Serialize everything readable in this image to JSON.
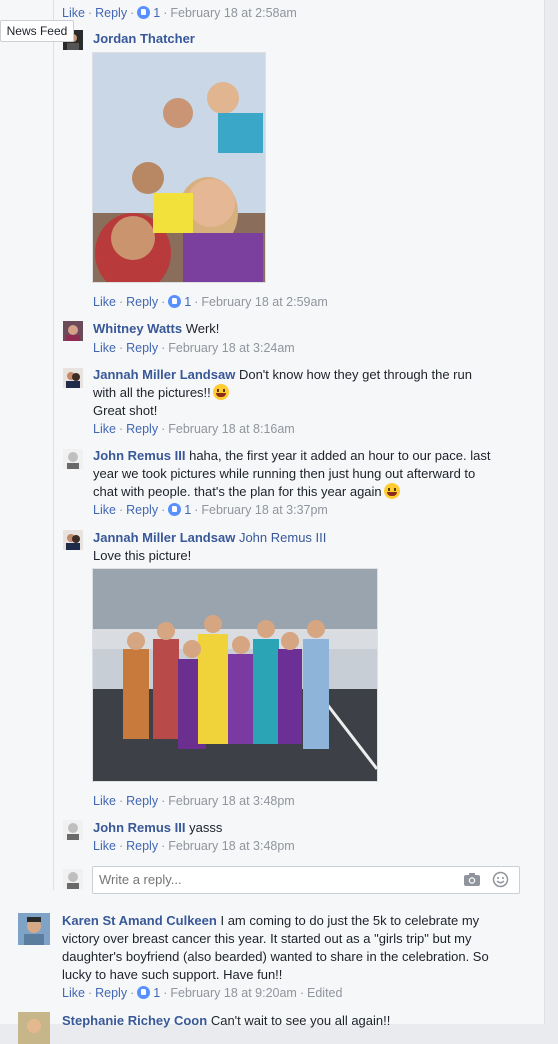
{
  "tooltip": "News Feed",
  "actions": {
    "like": "Like",
    "reply": "Reply"
  },
  "comments": [
    {
      "meta_like_count": "1",
      "time": "February 18 at 2:58am"
    },
    {
      "name": "Jordan Thatcher",
      "like_count": "1",
      "time": "February 18 at 2:59am"
    },
    {
      "name": "Whitney Watts",
      "text": "Werk!",
      "time": "February 18 at 3:24am"
    },
    {
      "name": "Jannah Miller Landsaw",
      "text_line1": "Don't know how they get through the run",
      "text_line2": "with all the pictures!!",
      "text_line3": "Great shot!",
      "time": "February 18 at 8:16am"
    },
    {
      "name": "John Remus III",
      "text_line1": "haha, the first year it added an hour to our pace. last",
      "text_line2": "year we took pictures while running then just hung out afterward to",
      "text_line3": "chat with people. that's the plan for this year again",
      "like_count": "1",
      "time": "February 18 at 3:37pm"
    },
    {
      "name": "Jannah Miller Landsaw",
      "mention": "John Remus III",
      "text": "Love this picture!",
      "time": "February 18 at 3:48pm"
    },
    {
      "name": "John Remus III",
      "text": "yasss",
      "time": "February 18 at 3:48pm"
    }
  ],
  "reply_input": {
    "placeholder": "Write a reply..."
  },
  "top_comments": [
    {
      "name": "Karen St Amand Culkeen",
      "text_line1": "I am coming to do just the 5k to celebrate my",
      "text_line2": "victory over breast cancer this year. It started out as a \"girls trip\" but my",
      "text_line3": "daughter's boyfriend (also bearded) wanted to share in the celebration. So",
      "text_line4": "lucky to have such support. Have fun!!",
      "like_count": "1",
      "time": "February 18 at 9:20am",
      "edited": "Edited"
    },
    {
      "name": "Stephanie Richey Coon",
      "text": "Can't wait to see you all again!!"
    }
  ],
  "colors": {
    "link": "#4267b2",
    "name": "#385898",
    "meta": "#90949c",
    "background": "#f6f7f9"
  }
}
